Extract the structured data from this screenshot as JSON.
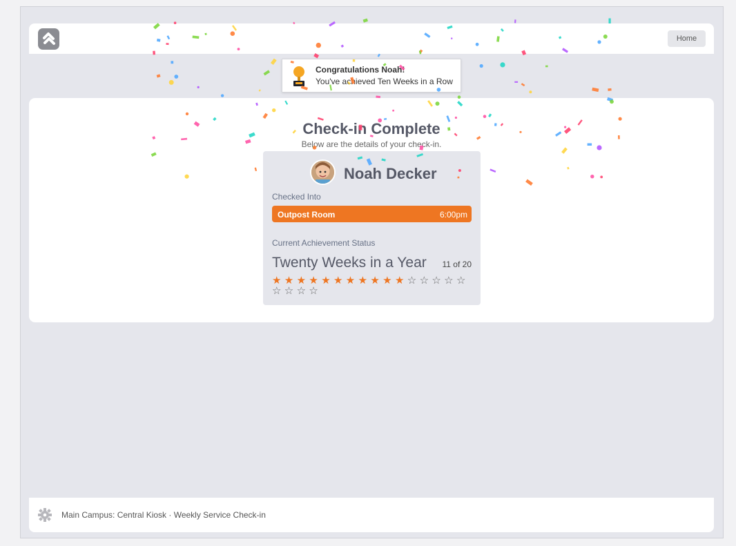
{
  "header": {
    "logo_icon": "rock-rms-logo-icon",
    "home_label": "Home"
  },
  "notification": {
    "icon": "trophy-icon",
    "title": "Congratulations Noah!",
    "message": "You've achieved Ten Weeks in a Row"
  },
  "checkin": {
    "title": "Check-in Complete",
    "subtitle": "Below are the details of your check-in.",
    "person": {
      "name": "Noah Decker",
      "avatar": "child-avatar-photo"
    },
    "checked_into_label": "Checked Into",
    "room": {
      "name": "Outpost Room",
      "time": "6:00pm",
      "color": "#ee7622"
    },
    "achievement_status_label": "Current Achievement Status",
    "achievement": {
      "name": "Twenty Weeks in a Year",
      "progress_text": "11 of 20",
      "completed": 11,
      "total": 20,
      "filled_star_color": "#ee7622"
    }
  },
  "footer": {
    "icon": "gear-icon",
    "text": "Main Campus: Central Kiosk · Weekly Service Check-in"
  },
  "colors": {
    "accent": "#ee7622",
    "page_background": "#e5e6ec",
    "card_background": "#ffffff"
  }
}
